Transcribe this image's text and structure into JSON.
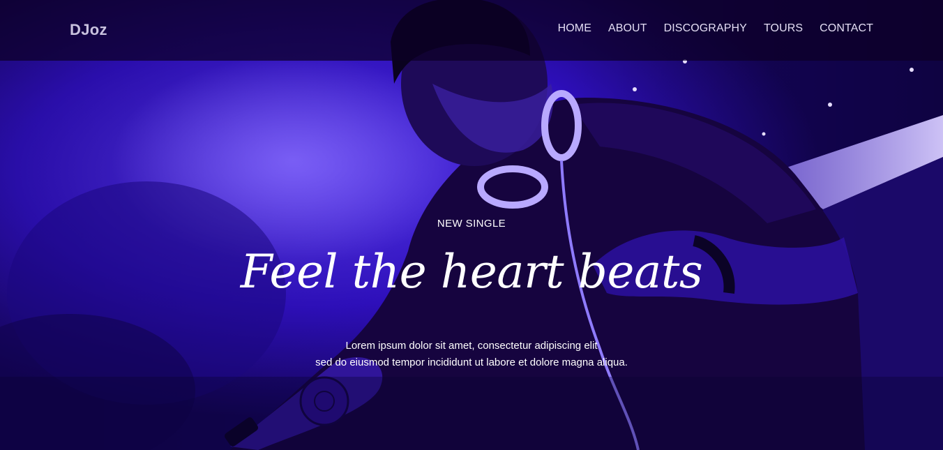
{
  "header": {
    "logo": "DJoz",
    "nav": [
      {
        "label": "HOME"
      },
      {
        "label": "ABOUT"
      },
      {
        "label": "DISCOGRAPHY"
      },
      {
        "label": "TOURS"
      },
      {
        "label": "CONTACT"
      }
    ]
  },
  "hero": {
    "eyebrow": "NEW SINGLE",
    "headline": "Feel the heart beats",
    "description_line1": "Lorem ipsum dolor sit amet, consectetur adipiscing elit",
    "description_line2": "sed do eiusmod tempor incididunt ut labore et dolore magna aliqua."
  },
  "colors": {
    "overlay": "#2a0cc0",
    "header_bg": "#0c0026",
    "text": "#ffffff"
  }
}
